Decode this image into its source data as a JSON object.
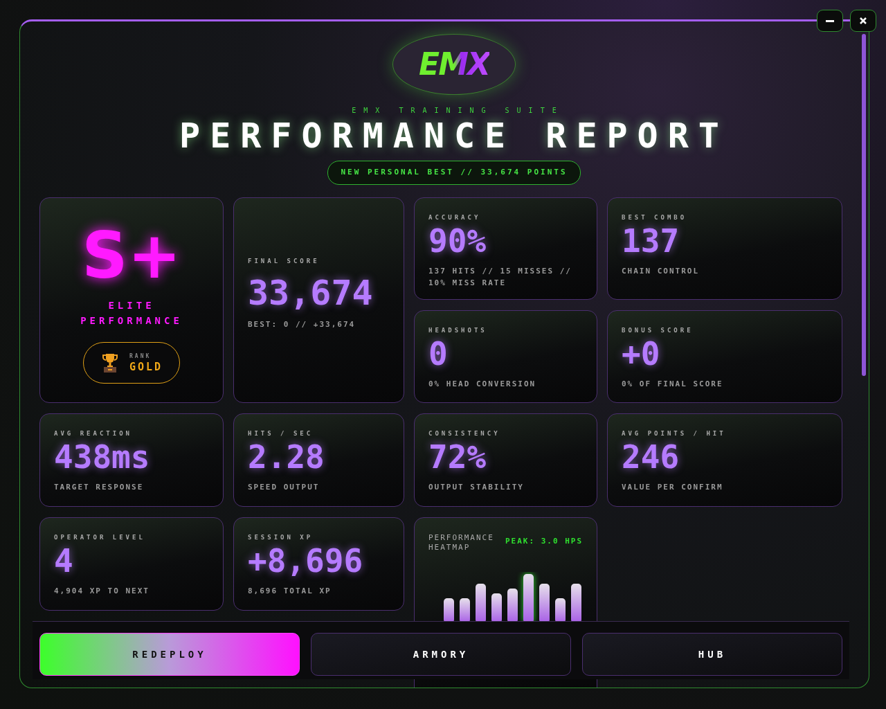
{
  "header": {
    "logo_text": "EMX",
    "subtitle": "EMX TRAINING SUITE",
    "title": "PERFORMANCE REPORT",
    "banner": "NEW PERSONAL BEST // 33,674 POINTS"
  },
  "cards": [
    {
      "kind": "grade",
      "grade": "S+",
      "label": "ELITE PERFORMANCE",
      "rank_label": "RANK",
      "rank_value": "GOLD"
    },
    {
      "kind": "featured",
      "label": "FINAL SCORE",
      "value": "33,674",
      "sub": "BEST: 0 // +33,674"
    },
    {
      "kind": "stat",
      "label": "ACCURACY",
      "value": "90%",
      "sub": "137 HITS // 15 MISSES // 10% MISS RATE"
    },
    {
      "kind": "stat",
      "label": "BEST COMBO",
      "value": "137",
      "sub": "CHAIN CONTROL"
    },
    {
      "kind": "stat",
      "label": "HEADSHOTS",
      "value": "0",
      "sub": "0% HEAD CONVERSION"
    },
    {
      "kind": "stat",
      "label": "BONUS SCORE",
      "value": "+0",
      "sub": "0% OF FINAL SCORE"
    },
    {
      "kind": "stat",
      "label": "AVG REACTION",
      "value": "438ms",
      "sub": "TARGET RESPONSE"
    },
    {
      "kind": "stat",
      "label": "HITS / SEC",
      "value": "2.28",
      "sub": "SPEED OUTPUT"
    },
    {
      "kind": "stat",
      "label": "CONSISTENCY",
      "value": "72%",
      "sub": "OUTPUT STABILITY"
    },
    {
      "kind": "stat",
      "label": "AVG POINTS / HIT",
      "value": "246",
      "sub": "VALUE PER CONFIRM"
    },
    {
      "kind": "stat",
      "label": "OPERATOR LEVEL",
      "value": "4",
      "sub": "4,904 XP TO NEXT"
    },
    {
      "kind": "stat",
      "label": "SESSION XP",
      "value": "+8,696",
      "sub": "8,696 TOTAL XP"
    },
    {
      "kind": "heatmap",
      "label": "PERFORMANCE HEATMAP",
      "peak": "PEAK: 3.0 HPS"
    }
  ],
  "footer_buttons": [
    {
      "label": "REDEPLOY",
      "kind": "primary"
    },
    {
      "label": "ARMORY",
      "kind": "secondary"
    },
    {
      "label": "HUB",
      "kind": "secondary"
    }
  ]
}
